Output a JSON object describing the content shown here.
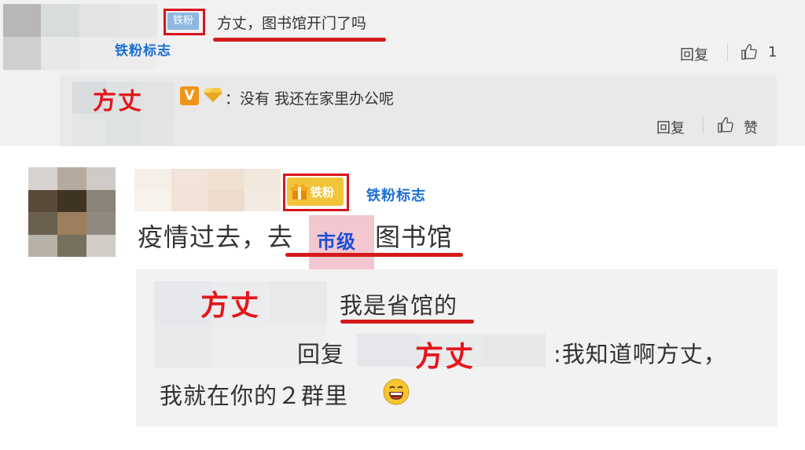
{
  "comment1": {
    "fan_badge": "铁粉",
    "fan_annotation": "铁粉标志",
    "text": "方丈，图书馆开门了吗",
    "reply_label": "回复",
    "like_count": "1"
  },
  "reply1": {
    "name_annotation": "方丈",
    "vip_letter": "V",
    "text": "：没有 我还在家里办公呢",
    "reply_label": "回复",
    "like_label": "赞"
  },
  "comment2": {
    "fan_badge": "铁粉",
    "fan_annotation": "铁粉标志",
    "text_part1": "疫情过去，去",
    "city_annotation": "市级",
    "text_part2": "图书馆"
  },
  "reply2": {
    "name_annotation": "方丈",
    "line1": "我是省馆的",
    "reply_word": "回复",
    "name_annotation2": "方丈",
    "line2_tail": ":我知道啊方丈，",
    "line3": "我就在你的２群里"
  },
  "colors": {
    "annotation_red": "#e3161c",
    "annotation_blue": "#1a6fd4",
    "highlight_box": "#d9141c",
    "vip_orange": "#f09419",
    "gold_badge": "#f2c43a"
  }
}
